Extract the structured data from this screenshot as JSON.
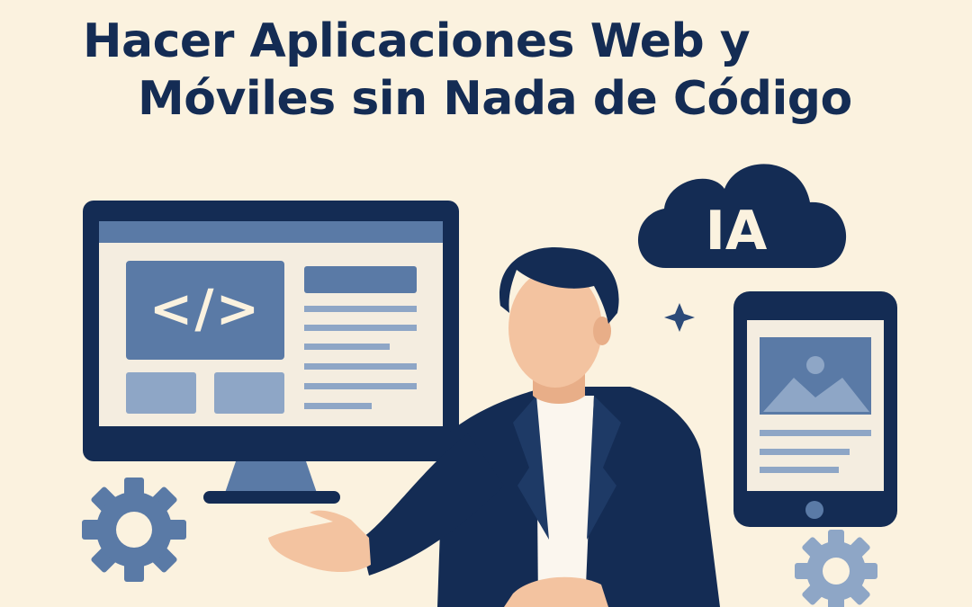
{
  "headline": {
    "line1": "Hacer Aplicaciones Web y",
    "line2": "Móviles sin Nada de Código"
  },
  "cloud": {
    "label": "IA",
    "icon": "cloud-icon"
  },
  "monitor": {
    "code_glyph": "</>",
    "icon": "desktop-monitor-icon"
  },
  "tablet": {
    "icon": "tablet-icon",
    "image_icon": "image-placeholder-icon"
  },
  "colors": {
    "background": "#fbf2df",
    "navy": "#142c54",
    "slate_blue": "#5a7aa6",
    "light_blue": "#8ea6c6",
    "screen": "#f4ede0",
    "skin": "#f3c3a0"
  }
}
